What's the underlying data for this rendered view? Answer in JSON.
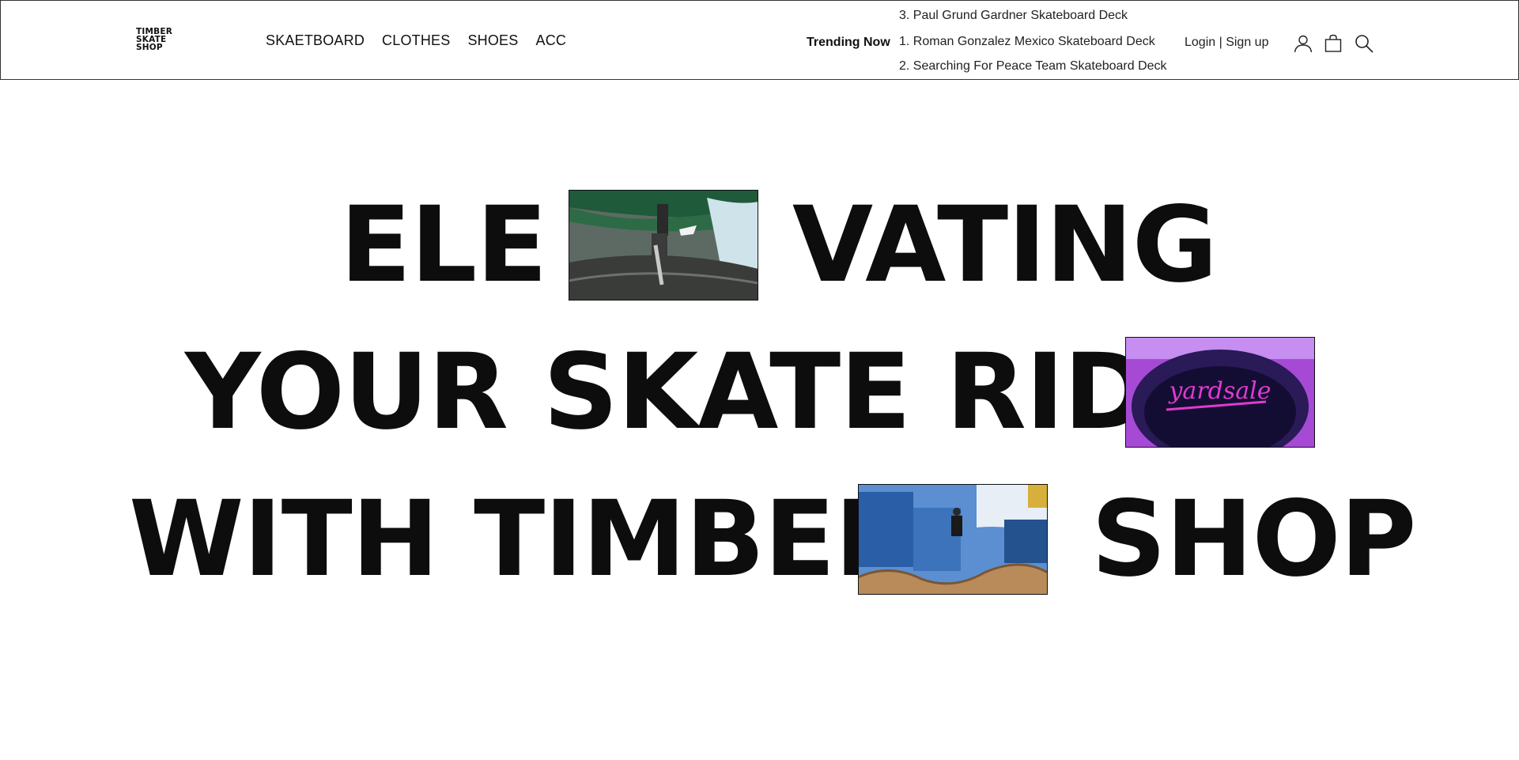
{
  "header": {
    "logo_lines": [
      "TIMBER",
      "SKATE",
      "SHOP"
    ],
    "nav": [
      "SKAETBOARD",
      "CLOTHES",
      "SHOES",
      "ACC"
    ],
    "trending_label": "Trending Now",
    "trending": [
      "3. Paul Grund Gardner Skateboard Deck",
      "1. Roman Gonzalez Mexico Skateboard Deck",
      "2. Searching For Peace Team Skateboard Deck"
    ],
    "auth_label": "Login | Sign up",
    "icons": [
      "user-icon",
      "shopping-bag-icon",
      "search-icon"
    ]
  },
  "hero": {
    "line1_left": "ELE",
    "line1_right": "VATING",
    "line2_left": "YOUR SKATE RIDE",
    "line3_left": "WITH TIMBER",
    "line3_right": "SHOP",
    "photo_sign_text": "yardsale",
    "photos": [
      "skateboarder-under-bridge-photo",
      "neon-yardsale-sign-photo",
      "skatepark-ramp-photo"
    ]
  }
}
